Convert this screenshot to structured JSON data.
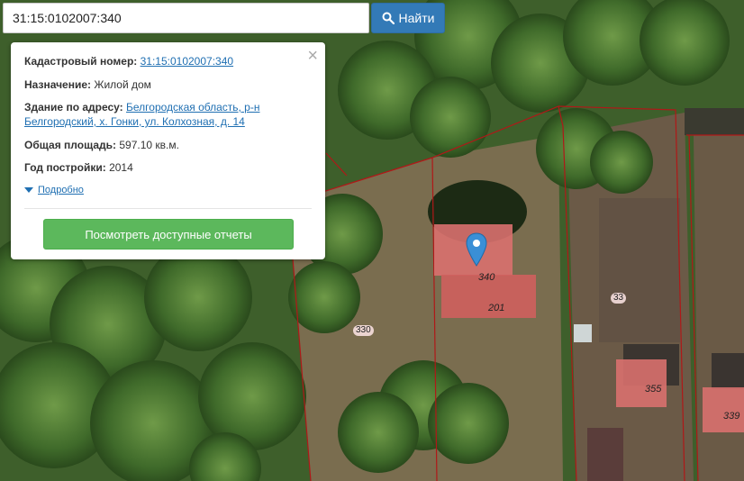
{
  "search": {
    "value": "31:15:0102007:340",
    "button_label": "Найти",
    "button_icon": "search-icon"
  },
  "popup": {
    "close_glyph": "×",
    "cadastral_label": "Кадастровый номер:",
    "cadastral_value": "31:15:0102007:340",
    "purpose_label": "Назначение:",
    "purpose_value": "Жилой дом",
    "address_label": "Здание по адресу:",
    "address_value": "Белгородская область, р-н Белгородский, х. Гонки, ул. Колхозная, д. 14",
    "area_label": "Общая площадь:",
    "area_value": "597.10 кв.м.",
    "year_label": "Год постройки:",
    "year_value": "2014",
    "details_label": "Подробно",
    "report_button": "Посмотреть доступные отчеты"
  },
  "map": {
    "parcel_labels": [
      "330",
      "33"
    ],
    "building_labels": [
      "340",
      "201",
      "355",
      "339"
    ],
    "boundary_color": "#b01818",
    "building_color": "#d9706e"
  }
}
